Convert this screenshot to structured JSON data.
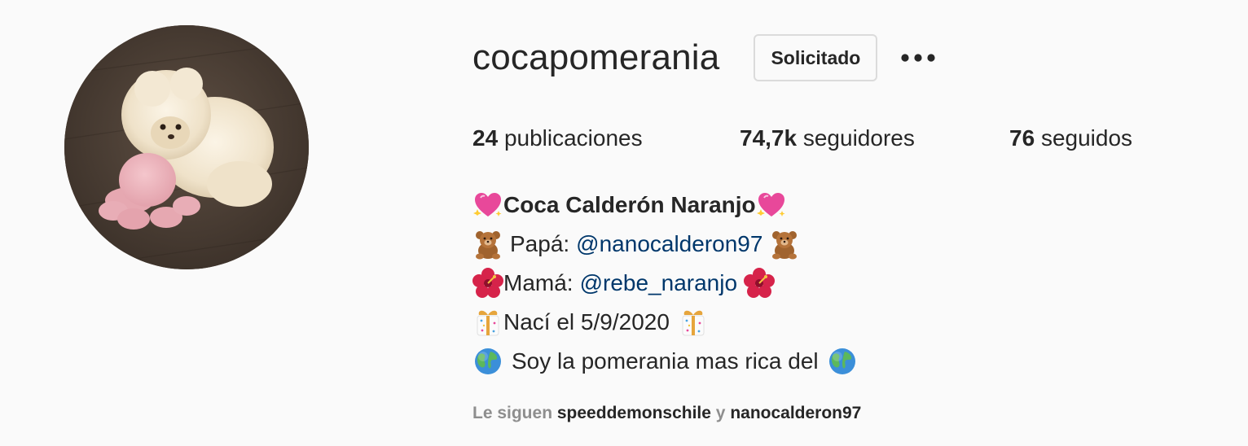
{
  "profile": {
    "username": "cocapomerania",
    "follow_button_label": "Solicitado",
    "stats": {
      "posts_count": "24",
      "posts_label": "publicaciones",
      "followers_count": "74,7k",
      "followers_label": "seguidores",
      "following_count": "76",
      "following_label": "seguidos"
    },
    "bio": {
      "name": "Coca Calderón Naranjo",
      "dad_label": "Papá:",
      "dad_mention": "@nanocalderon97",
      "mom_label": "Mamá:",
      "mom_mention": "@rebe_naranjo",
      "birth_text": "Nací el 5/9/2020",
      "tagline": "Soy la pomerania mas rica del"
    },
    "followed_by": {
      "prefix": "Le siguen",
      "account_1": "speeddemonschile",
      "joiner": "y",
      "account_2": "nanocalderon97"
    }
  },
  "icons": {
    "avatar": "pomeranian-dog-photo",
    "more": "more-options-icon",
    "heart": "sparkling-heart-emoji",
    "bear": "teddy-bear-emoji",
    "flower": "hibiscus-emoji",
    "gift": "wrapped-gift-emoji",
    "globe": "globe-emoji"
  },
  "colors": {
    "background": "#fafafa",
    "text": "#262626",
    "mention": "#00376b",
    "muted": "#8e8e8e",
    "border": "#dbdbdb"
  }
}
